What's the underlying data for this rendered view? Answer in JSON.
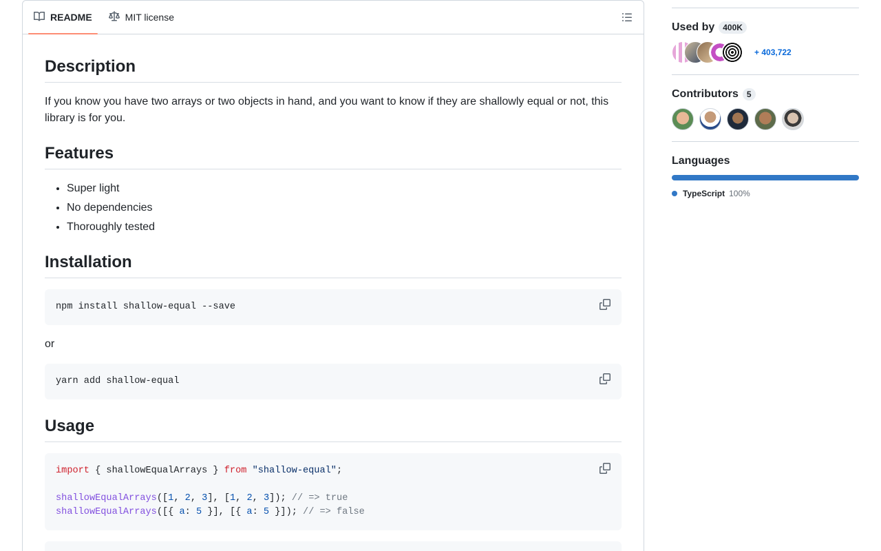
{
  "readme": {
    "tabs": [
      {
        "label": "README",
        "icon": "book-icon",
        "active": true
      },
      {
        "label": "MIT license",
        "icon": "law-icon",
        "active": false
      }
    ],
    "sections": {
      "description": {
        "heading": "Description",
        "text": "If you know you have two arrays or two objects in hand, and you want to know if they are shallowly equal or not, this library is for you."
      },
      "features": {
        "heading": "Features",
        "items": [
          "Super light",
          "No dependencies",
          "Thoroughly tested"
        ]
      },
      "installation": {
        "heading": "Installation",
        "npm_cmd": "npm install shallow-equal --save",
        "or_text": "or",
        "yarn_cmd": "yarn add shallow-equal"
      },
      "usage": {
        "heading": "Usage",
        "import_kw": "import",
        "import_names": " { shallowEqualArrays } ",
        "from_kw": "from",
        "import_src": "\"shallow-equal\"",
        "semicolon": ";",
        "fn_name": "shallowEqualArrays",
        "comment_true": "// => true",
        "comment_false": "// => false"
      }
    }
  },
  "sidebar": {
    "used_by": {
      "label": "Used by",
      "count": "400K",
      "more": "+ 403,722"
    },
    "contributors": {
      "label": "Contributors",
      "count": "5"
    },
    "languages": {
      "label": "Languages",
      "items": [
        {
          "name": "TypeScript",
          "percent": "100%",
          "color": "#3178c6"
        }
      ]
    }
  },
  "colors": {
    "accent_tab": "#fd8c73",
    "link": "#0969da",
    "typescript": "#3178c6"
  }
}
